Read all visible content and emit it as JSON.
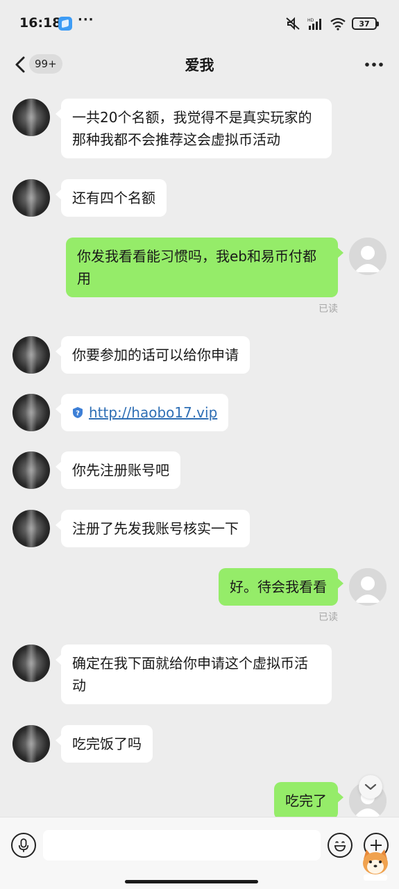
{
  "status_bar": {
    "time": "16:18",
    "more": "···",
    "battery": "37",
    "icons": [
      "app-notification-icon",
      "mute-icon",
      "hd-signal-icon",
      "wifi-icon",
      "battery-icon"
    ]
  },
  "header": {
    "unread_count": "99+",
    "title": "爱我",
    "icons": [
      "back-arrow-icon",
      "more-dots-icon"
    ]
  },
  "messages": [
    {
      "side": "them",
      "text": "一共20个名额，我觉得不是真实玩家的那种我都不会推荐这会虚拟币活动"
    },
    {
      "side": "them",
      "text": "还有四个名额"
    },
    {
      "side": "me",
      "text": "你发我看看能习惯吗，我eb和易币付都用",
      "status": "已读"
    },
    {
      "side": "them",
      "text": "你要参加的话可以给你申请"
    },
    {
      "side": "them",
      "type": "link",
      "text": "http://haobo17.vip"
    },
    {
      "side": "them",
      "text": "你先注册账号吧"
    },
    {
      "side": "them",
      "text": "注册了先发我账号核实一下"
    },
    {
      "side": "me",
      "text": "好。待会我看看",
      "status": "已读"
    },
    {
      "side": "them",
      "text": "确定在我下面就给你申请这个虚拟币活动"
    },
    {
      "side": "them",
      "text": "吃完饭了吗"
    },
    {
      "side": "me",
      "text": "吃完了"
    }
  ],
  "input": {
    "placeholder": "",
    "icons": [
      "voice-icon",
      "emoji-icon",
      "plus-icon",
      "chevron-down-icon"
    ]
  },
  "colors": {
    "background": "#ededed",
    "bubble_them": "#ffffff",
    "bubble_me": "#95ec69",
    "link": "#2f6fb5",
    "read_mark": "#a6a6a6"
  }
}
